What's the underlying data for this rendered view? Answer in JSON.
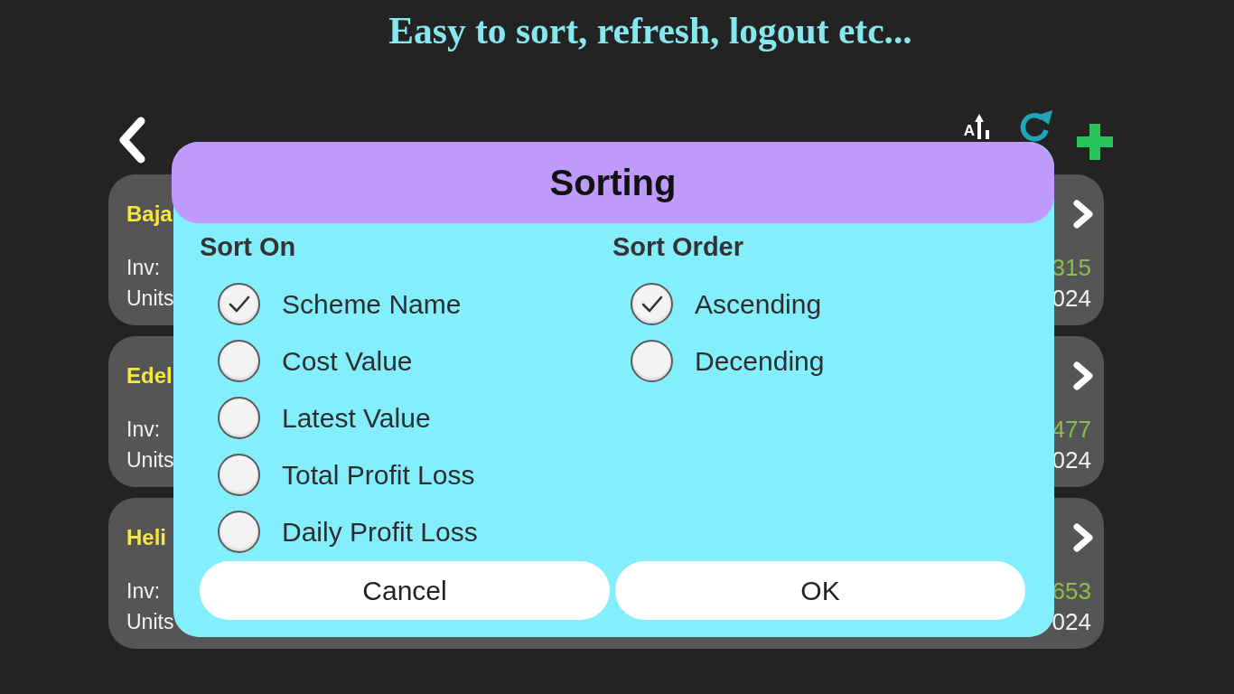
{
  "caption": "Easy to sort, refresh, logout etc...",
  "toolbar": {
    "sort_letter": "A"
  },
  "schemes": [
    {
      "title": "Baja",
      "inv_label": "Inv:",
      "inv_value": "315",
      "units_label": "Units",
      "units_value": "024"
    },
    {
      "title": "Edel",
      "inv_label": "Inv:",
      "inv_value": "477",
      "units_label": "Units",
      "units_value": "024"
    },
    {
      "title": "Heli",
      "inv_label": "Inv:",
      "inv_value": "653",
      "units_label": "Units",
      "units_value": "024"
    }
  ],
  "dialog": {
    "title": "Sorting",
    "groups": [
      {
        "heading": "Sort On",
        "options": [
          {
            "label": "Scheme Name",
            "selected": true
          },
          {
            "label": "Cost Value",
            "selected": false
          },
          {
            "label": "Latest Value",
            "selected": false
          },
          {
            "label": "Total Profit Loss",
            "selected": false
          },
          {
            "label": "Daily Profit Loss",
            "selected": false
          }
        ]
      },
      {
        "heading": "Sort Order",
        "options": [
          {
            "label": "Ascending",
            "selected": true
          },
          {
            "label": "Decending",
            "selected": false
          }
        ]
      }
    ],
    "buttons": [
      "Cancel",
      "OK"
    ]
  }
}
